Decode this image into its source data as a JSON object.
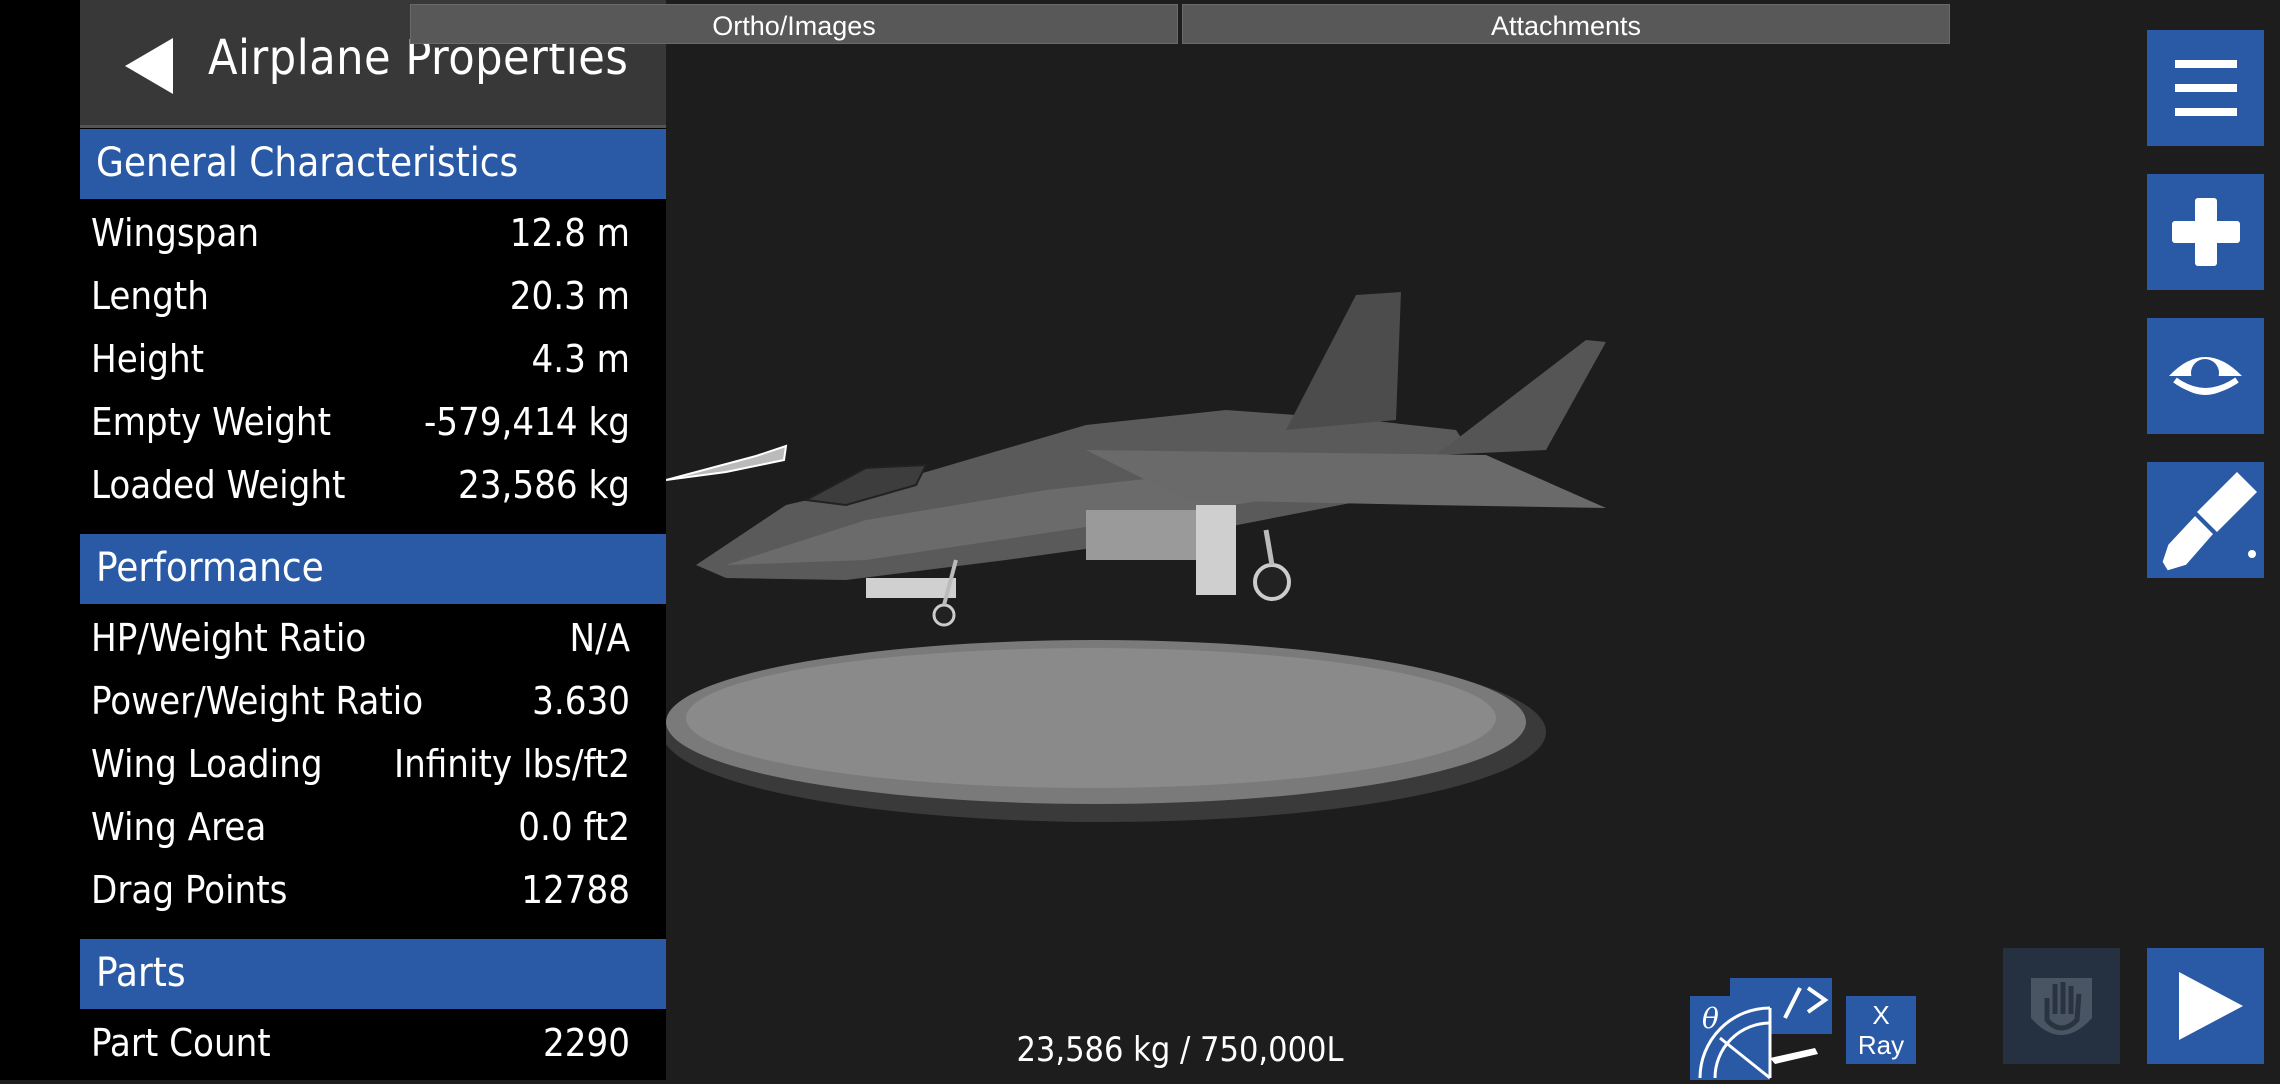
{
  "panel": {
    "title": "Airplane Properties",
    "sections": {
      "general": {
        "title": "General Characteristics",
        "rows": [
          {
            "label": "Wingspan",
            "value": "12.8 m"
          },
          {
            "label": "Length",
            "value": "20.3 m"
          },
          {
            "label": "Height",
            "value": "4.3 m"
          },
          {
            "label": "Empty Weight",
            "value": "-579,414 kg"
          },
          {
            "label": "Loaded Weight",
            "value": "23,586 kg"
          }
        ]
      },
      "performance": {
        "title": "Performance",
        "rows": [
          {
            "label": "HP/Weight Ratio",
            "value": "N/A"
          },
          {
            "label": "Power/Weight Ratio",
            "value": "3.630"
          },
          {
            "label": "Wing Loading",
            "value": "Infinity lbs/ft2"
          },
          {
            "label": "Wing Area",
            "value": "0.0 ft2"
          },
          {
            "label": "Drag Points",
            "value": "12788"
          }
        ]
      },
      "parts": {
        "title": "Parts",
        "rows": [
          {
            "label": "Part Count",
            "value": "2290"
          }
        ]
      }
    }
  },
  "tabs": {
    "ortho": "Ortho/Images",
    "attachments": "Attachments"
  },
  "toolbar": {
    "menu_icon": "hamburger-menu-icon",
    "add_icon": "plus-icon",
    "view_icon": "eye-icon",
    "paint_icon": "paint-brush-icon",
    "hand_icon": "hand-icon",
    "play_icon": "play-icon",
    "xray_line1": "X",
    "xray_line2": "Ray"
  },
  "status": {
    "weight_fuel": "23,586 kg / 750,000L"
  },
  "colors": {
    "accent_blue": "#2a5aa5",
    "panel_bg": "#000000",
    "viewport_bg": "#1d1d1d",
    "header_bg": "#383838"
  }
}
